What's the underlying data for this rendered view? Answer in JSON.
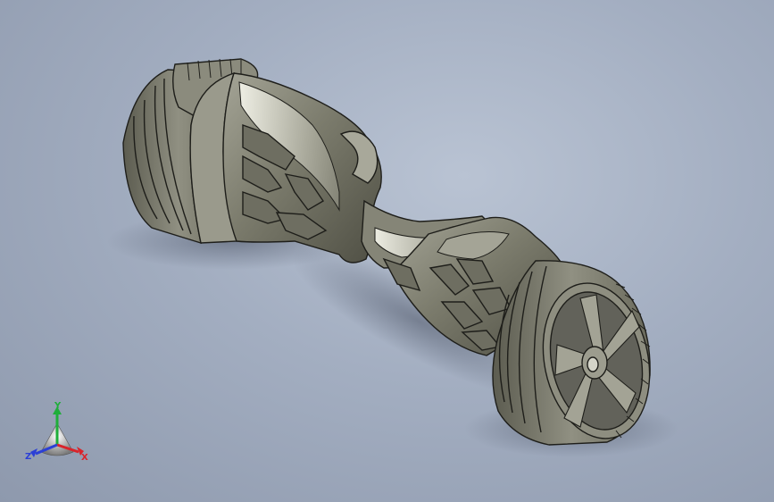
{
  "viewport": {
    "background_top": "#b9c3d3",
    "background_bottom": "#8e99ad",
    "model": {
      "body_color": "#7d7d6f",
      "highlight_color": "#e8e8dc",
      "edge_color": "#1e1e1a"
    }
  },
  "triad": {
    "x_label": "X",
    "y_label": "Y",
    "z_label": "Z",
    "x_color": "#d9242b",
    "y_color": "#1fae3a",
    "z_color": "#2b3fd6"
  }
}
